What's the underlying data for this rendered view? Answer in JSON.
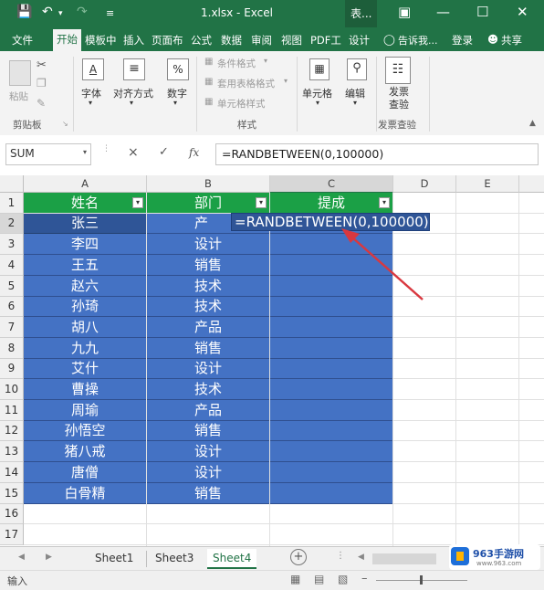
{
  "titlebar": {
    "filename": "1.xlsx - Excel",
    "context_tab": "表...",
    "save_icon": "save-icon",
    "undo_icon": "undo-icon",
    "redo_icon": "redo-icon",
    "custom_icon": "customize-icon"
  },
  "menu": {
    "tabs": [
      "文件",
      "开始",
      "模板中",
      "插入",
      "页面布",
      "公式",
      "数据",
      "审阅",
      "视图",
      "PDF工",
      "设计"
    ],
    "active_tab": "开始",
    "tell_me": "告诉我...",
    "login": "登录",
    "share": "共享"
  },
  "ribbon": {
    "paste": "粘贴",
    "clipboard_group": "剪贴板",
    "font": "字体",
    "align": "对齐方式",
    "number": "数字",
    "conditional_format": "条件格式",
    "table_format": "套用表格格式",
    "cell_style": "单元格样式",
    "style_group": "样式",
    "cells": "单元格",
    "edit": "编辑",
    "invoice_check": "发票查验",
    "invoice_group": "发票查验",
    "percent_icon": "%"
  },
  "formula_bar": {
    "name_box": "SUM",
    "cancel": "×",
    "enter": "✓",
    "fx": "fx",
    "formula": "=RANDBETWEEN(0,100000)"
  },
  "grid": {
    "columns": [
      "A",
      "B",
      "C",
      "D",
      "E"
    ],
    "rows": [
      "1",
      "2",
      "3",
      "4",
      "5",
      "6",
      "7",
      "8",
      "9",
      "10",
      "11",
      "12",
      "13",
      "14",
      "15",
      "16",
      "17"
    ],
    "header": [
      "姓名",
      "部门",
      "提成"
    ],
    "data": [
      [
        "张三",
        "产"
      ],
      [
        "李四",
        "设计"
      ],
      [
        "王五",
        "销售"
      ],
      [
        "赵六",
        "技术"
      ],
      [
        "孙琦",
        "技术"
      ],
      [
        "胡八",
        "产品"
      ],
      [
        "九九",
        "销售"
      ],
      [
        "艾什",
        "设计"
      ],
      [
        "曹操",
        "技术"
      ],
      [
        "周瑜",
        "产品"
      ],
      [
        "孙悟空",
        "销售"
      ],
      [
        "猪八戒",
        "设计"
      ],
      [
        "唐僧",
        "设计"
      ],
      [
        "白骨精",
        "销售"
      ]
    ],
    "editing_formula": "=RANDBETWEEN(0,100000)"
  },
  "sheets": {
    "tabs": [
      "Sheet1",
      "Sheet3",
      "Sheet4"
    ],
    "active": "Sheet4",
    "add": "+"
  },
  "status": {
    "mode": "输入"
  },
  "watermark": {
    "brand": "963手游网",
    "url": "www.963.com"
  },
  "colors": {
    "excel_green": "#217346",
    "header_green": "#1ba046",
    "selection_blue": "#4472c4",
    "dark_blue": "#2f5597",
    "arrow_red": "#d9383f"
  }
}
